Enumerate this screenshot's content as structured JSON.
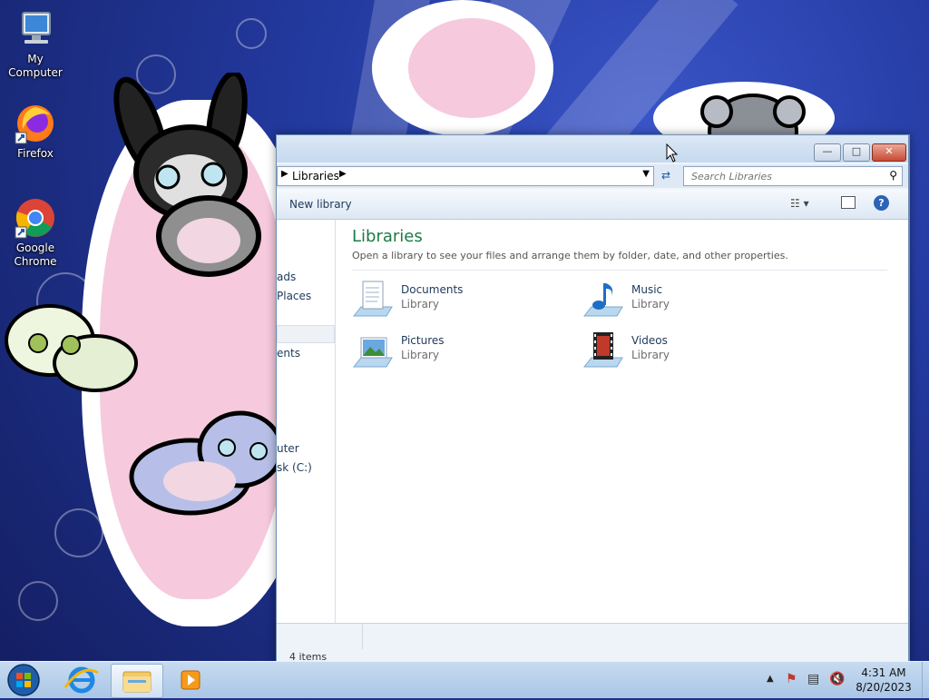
{
  "desktop": {
    "icons": [
      {
        "label": "My Computer",
        "icon": "computer-icon"
      },
      {
        "label": "Firefox",
        "icon": "firefox-icon"
      },
      {
        "label": "Google Chrome",
        "icon": "chrome-icon"
      }
    ]
  },
  "window": {
    "breadcrumb": "Libraries",
    "search_placeholder": "Search Libraries",
    "toolbar": {
      "new_library": "New library"
    },
    "nav_items": [
      "ads",
      "Places",
      "ents",
      "uter",
      "sk (C:)"
    ],
    "content": {
      "title": "Libraries",
      "subtitle": "Open a library to see your files and arrange them by folder, date, and other properties.",
      "items": [
        {
          "name": "Documents",
          "type": "Library",
          "icon": "documents-library-icon"
        },
        {
          "name": "Music",
          "type": "Library",
          "icon": "music-library-icon"
        },
        {
          "name": "Pictures",
          "type": "Library",
          "icon": "pictures-library-icon"
        },
        {
          "name": "Videos",
          "type": "Library",
          "icon": "videos-library-icon"
        }
      ]
    },
    "status": {
      "count": "4 items"
    }
  },
  "taskbar": {
    "clock_time": "4:31 AM",
    "clock_date": "8/20/2023",
    "pinned": [
      "start-orb",
      "internet-explorer-icon",
      "file-explorer-icon",
      "media-player-icon"
    ]
  },
  "colors": {
    "accent": "#1e5aa8",
    "title_green": "#1e7a46",
    "wallpaper": "#233aa0"
  }
}
